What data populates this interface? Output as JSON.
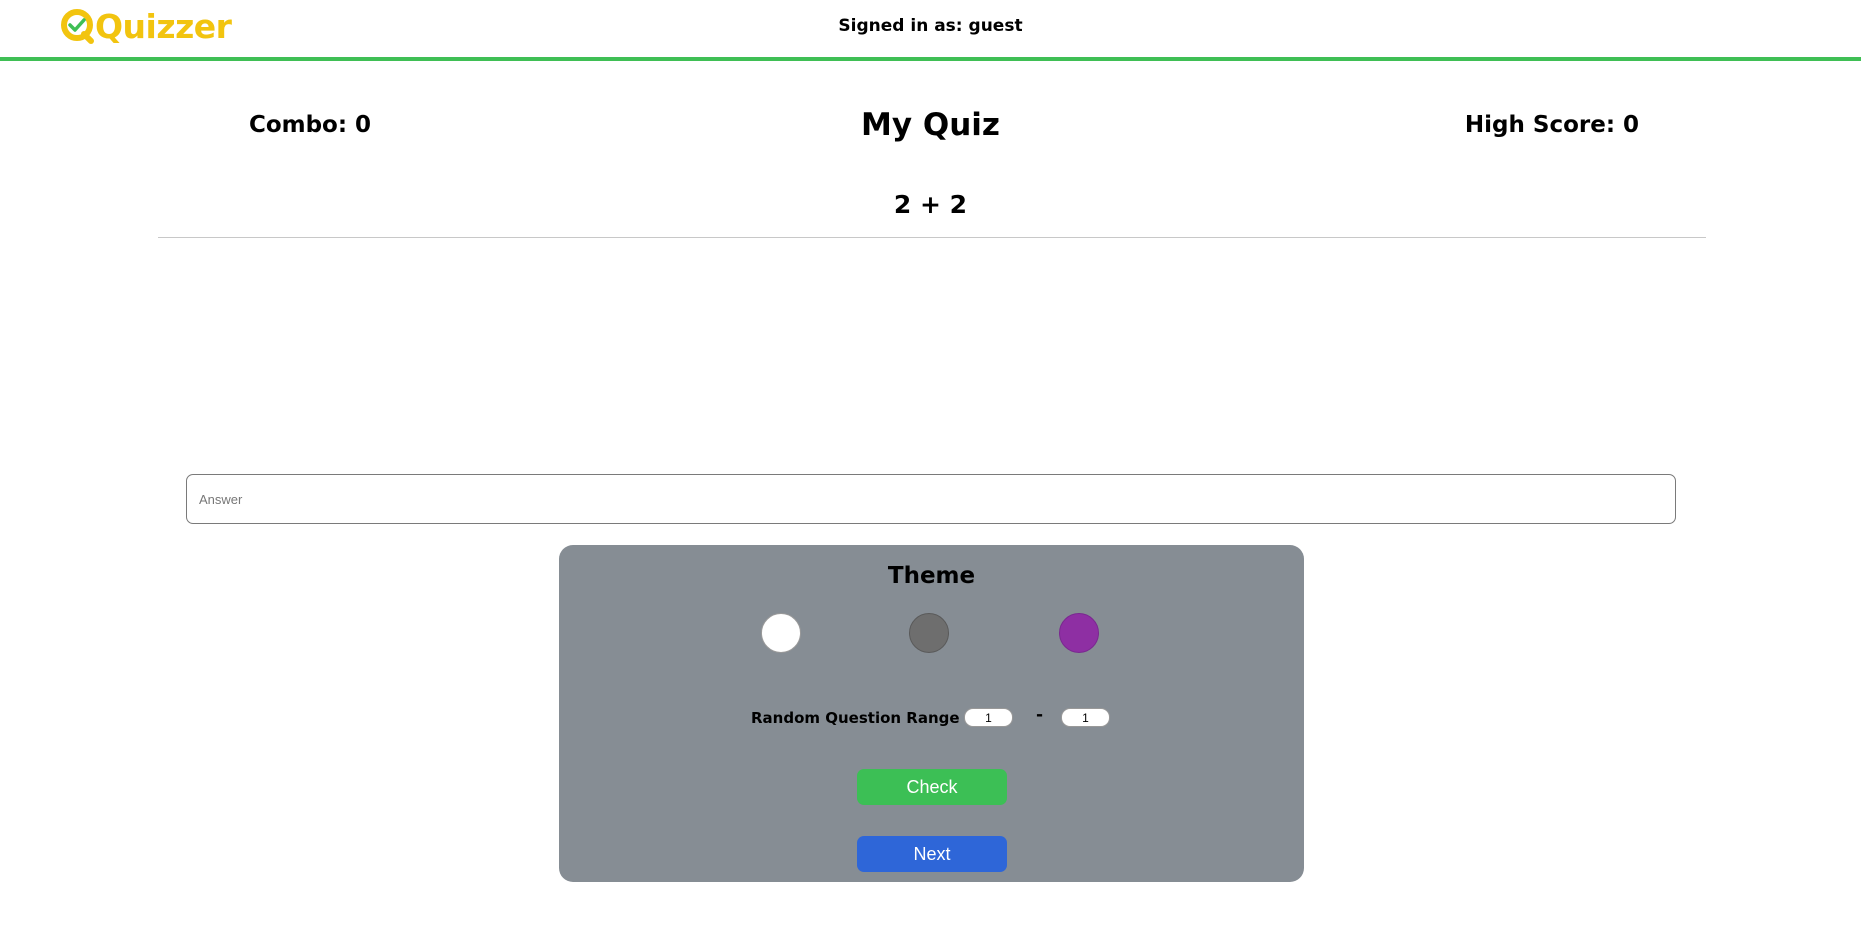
{
  "header": {
    "logo_text": "Quizzer",
    "signed_in_text": "Signed in as: guest",
    "accent_color": "#3fbf55",
    "logo_color": "#f2c40f"
  },
  "scores": {
    "combo": "Combo: 0",
    "high_score": "High Score: 0"
  },
  "quiz": {
    "title": "My Quiz",
    "question": "2 + 2"
  },
  "answer": {
    "placeholder": "Answer",
    "value": ""
  },
  "settings": {
    "theme_title": "Theme",
    "themes": [
      {
        "name": "white",
        "color": "#ffffff"
      },
      {
        "name": "grey",
        "color": "#6e6e6e"
      },
      {
        "name": "purple",
        "color": "#8e2fa3"
      }
    ],
    "range_label": "Random Question Range",
    "range_min": "1",
    "range_separator": "-",
    "range_max": "1",
    "panel_color": "#868d94"
  },
  "buttons": {
    "check_label": "Check",
    "check_color": "#3cbf55",
    "next_label": "Next",
    "next_color": "#2e66d8"
  }
}
